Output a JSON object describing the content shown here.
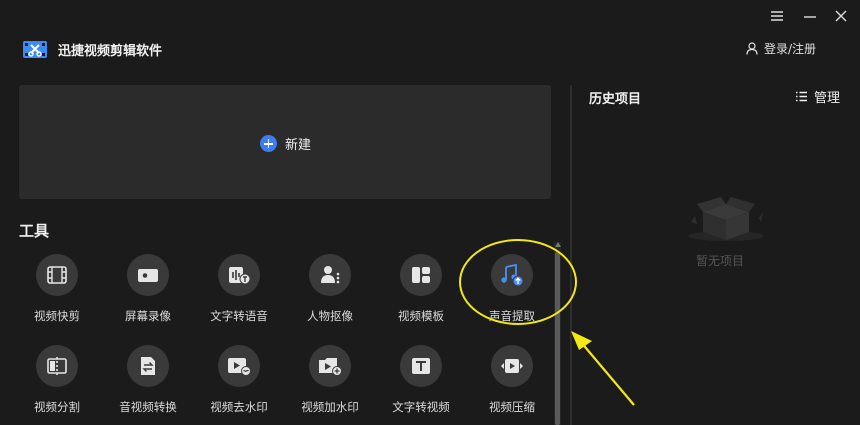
{
  "app": {
    "title": "迅捷视频剪辑软件",
    "login_label": "登录/注册"
  },
  "window_controls": [
    "menu-icon",
    "minimize-icon",
    "close-icon"
  ],
  "new_project": {
    "label": "新建"
  },
  "tools": {
    "heading": "工具",
    "items": [
      {
        "label": "视频快剪",
        "icon": "film-icon"
      },
      {
        "label": "屏幕录像",
        "icon": "camera-icon"
      },
      {
        "label": "文字转语音",
        "icon": "text-to-speech-icon"
      },
      {
        "label": "人物抠像",
        "icon": "person-cutout-icon"
      },
      {
        "label": "视频模板",
        "icon": "template-icon"
      },
      {
        "label": "声音提取",
        "icon": "audio-extract-icon"
      },
      {
        "label": "视频分割",
        "icon": "split-icon"
      },
      {
        "label": "音视频转换",
        "icon": "convert-icon"
      },
      {
        "label": "视频去水印",
        "icon": "remove-watermark-icon"
      },
      {
        "label": "视频加水印",
        "icon": "add-watermark-icon"
      },
      {
        "label": "文字转视频",
        "icon": "text-to-video-icon"
      },
      {
        "label": "视频压缩",
        "icon": "compress-icon"
      }
    ]
  },
  "history": {
    "title": "历史项目",
    "manage_label": "管理",
    "empty_text": "暂无项目"
  },
  "colors": {
    "background": "#1b1b1b",
    "panel": "#2b2b2b",
    "accent": "#3b7ef0",
    "highlight": "#f2ea12"
  }
}
